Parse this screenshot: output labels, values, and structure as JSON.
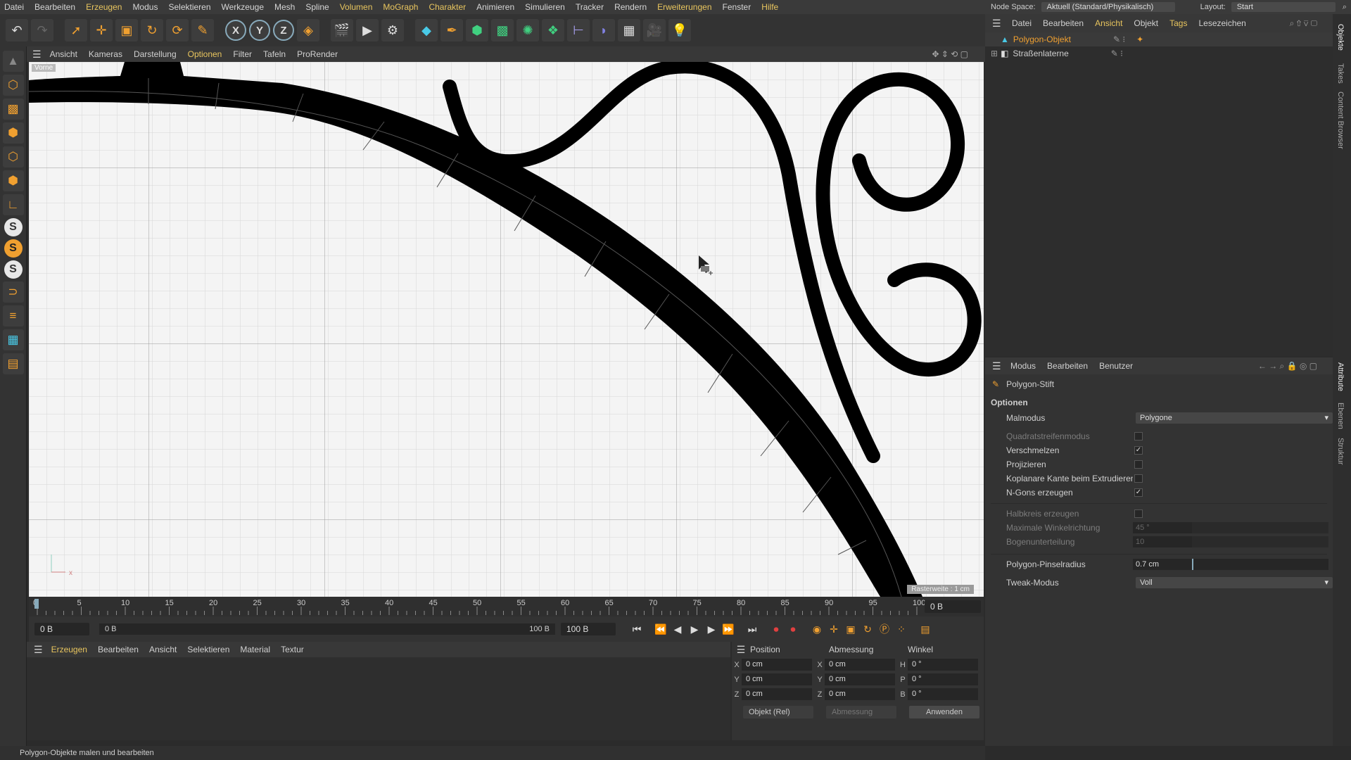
{
  "menu": [
    "Datei",
    "Bearbeiten",
    "Erzeugen",
    "Modus",
    "Selektieren",
    "Werkzeuge",
    "Mesh",
    "Spline",
    "Volumen",
    "MoGraph",
    "Charakter",
    "Animieren",
    "Simulieren",
    "Tracker",
    "Rendern",
    "Erweiterungen",
    "Fenster",
    "Hilfe"
  ],
  "toolbar": {
    "x": "X",
    "y": "Y",
    "z": "Z"
  },
  "viewport": {
    "menu": [
      "Ansicht",
      "Kameras",
      "Darstellung",
      "Optionen",
      "Filter",
      "Tafeln",
      "ProRender"
    ],
    "label": "Vorne",
    "raster": "Rasterweite : 1 cm",
    "axis_x": "x"
  },
  "timeline": {
    "ticks": [
      "0",
      "5",
      "10",
      "15",
      "20",
      "25",
      "30",
      "35",
      "40",
      "45",
      "50",
      "55",
      "60",
      "65",
      "70",
      "75",
      "80",
      "85",
      "90",
      "95",
      "100"
    ],
    "current_frame": "0 B",
    "start": "0 B",
    "range_start": "0 B",
    "range_end": "100 B",
    "end": "100 B"
  },
  "material": {
    "menu": [
      "Erzeugen",
      "Bearbeiten",
      "Ansicht",
      "Selektieren",
      "Material",
      "Textur"
    ]
  },
  "coords": {
    "headers": [
      "Position",
      "Abmessung",
      "Winkel"
    ],
    "rows": [
      {
        "a1": "X",
        "v1": "0 cm",
        "a2": "X",
        "v2": "0 cm",
        "a3": "H",
        "v3": "0 °"
      },
      {
        "a1": "Y",
        "v1": "0 cm",
        "a2": "Y",
        "v2": "0 cm",
        "a3": "P",
        "v3": "0 °"
      },
      {
        "a1": "Z",
        "v1": "0 cm",
        "a2": "Z",
        "v2": "0 cm",
        "a3": "B",
        "v3": "0 °"
      }
    ],
    "mode": "Objekt (Rel)",
    "size_mode": "Abmessung",
    "apply": "Anwenden"
  },
  "status": "Polygon-Objekte malen und bearbeiten",
  "right": {
    "node_space_label": "Node Space:",
    "node_space_value": "Aktuell (Standard/Physikalisch)",
    "layout_label": "Layout:",
    "layout_value": "Start",
    "obj_menu": [
      "Datei",
      "Bearbeiten",
      "Ansicht",
      "Objekt",
      "Tags",
      "Lesezeichen"
    ],
    "objects": [
      "Polygon-Objekt",
      "Straßenlaterne"
    ],
    "attr_menu": [
      "Modus",
      "Bearbeiten",
      "Benutzer"
    ],
    "tool_name": "Polygon-Stift",
    "section": "Optionen",
    "malmodus_label": "Malmodus",
    "malmodus_value": "Polygone",
    "checks": [
      {
        "label": "Quadratstreifenmodus",
        "checked": "",
        "dim": true
      },
      {
        "label": "Verschmelzen",
        "checked": "✓",
        "dim": false
      },
      {
        "label": "Projizieren",
        "checked": "",
        "dim": false
      },
      {
        "label": "Koplanare Kante beim Extrudieren",
        "checked": "",
        "dim": false
      },
      {
        "label": "N-Gons erzeugen",
        "checked": "✓",
        "dim": false
      }
    ],
    "halbkreis": "Halbkreis erzeugen",
    "winkel_label": "Maximale Winkelrichtung",
    "winkel_value": "45 °",
    "bogen_label": "Bogenunterteilung",
    "bogen_value": "10",
    "radius_label": "Polygon-Pinselradius",
    "radius_value": "0.7 cm",
    "tweak_label": "Tweak-Modus",
    "tweak_value": "Voll",
    "vtabs": [
      "Objekte",
      "Takes",
      "Content Browser",
      "Attribute",
      "Ebenen",
      "Struktur"
    ]
  },
  "colors": {
    "accent": "#f0a030",
    "highlight": "#e8c55e",
    "stroke": "#000000",
    "grid": "#cfcfcf"
  }
}
